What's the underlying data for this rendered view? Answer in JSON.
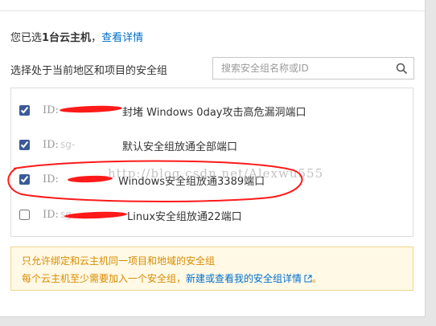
{
  "dialog": {
    "selected_prefix": "您已选",
    "selected_count": "1台云主机",
    "selected_sep": "，",
    "details_link": "查看详情",
    "choose_label": "选择处于当前地区和项目的安全组",
    "search": {
      "placeholder": "搜索安全组名称或ID",
      "value": ""
    },
    "id_label": "ID:",
    "security_groups": [
      {
        "id_text": "",
        "name": "封堵 Windows 0day攻击高危漏洞端口",
        "checked": true
      },
      {
        "id_text": "sg-",
        "name": "默认安全组放通全部端口",
        "checked": true
      },
      {
        "id_text": "",
        "name": "Windows安全组放通3389端口",
        "checked": true
      },
      {
        "id_text": "sg-",
        "name": "Linux安全组放通22端口",
        "checked": false
      }
    ],
    "notice": {
      "line1": "只允许绑定和云主机同一项目和地域的安全组",
      "line2_prefix": "每个云主机至少需要加入一个安全组，",
      "line2_link": "新建或查看我的安全组详情",
      "line2_suffix": "。"
    },
    "watermark": "http://blog.csdn.net/Alexwu555"
  },
  "colors": {
    "link": "#0070cc",
    "notice_text": "#d98b00",
    "notice_bg": "#fff9e6",
    "annotation_red": "#ff1a1a"
  }
}
